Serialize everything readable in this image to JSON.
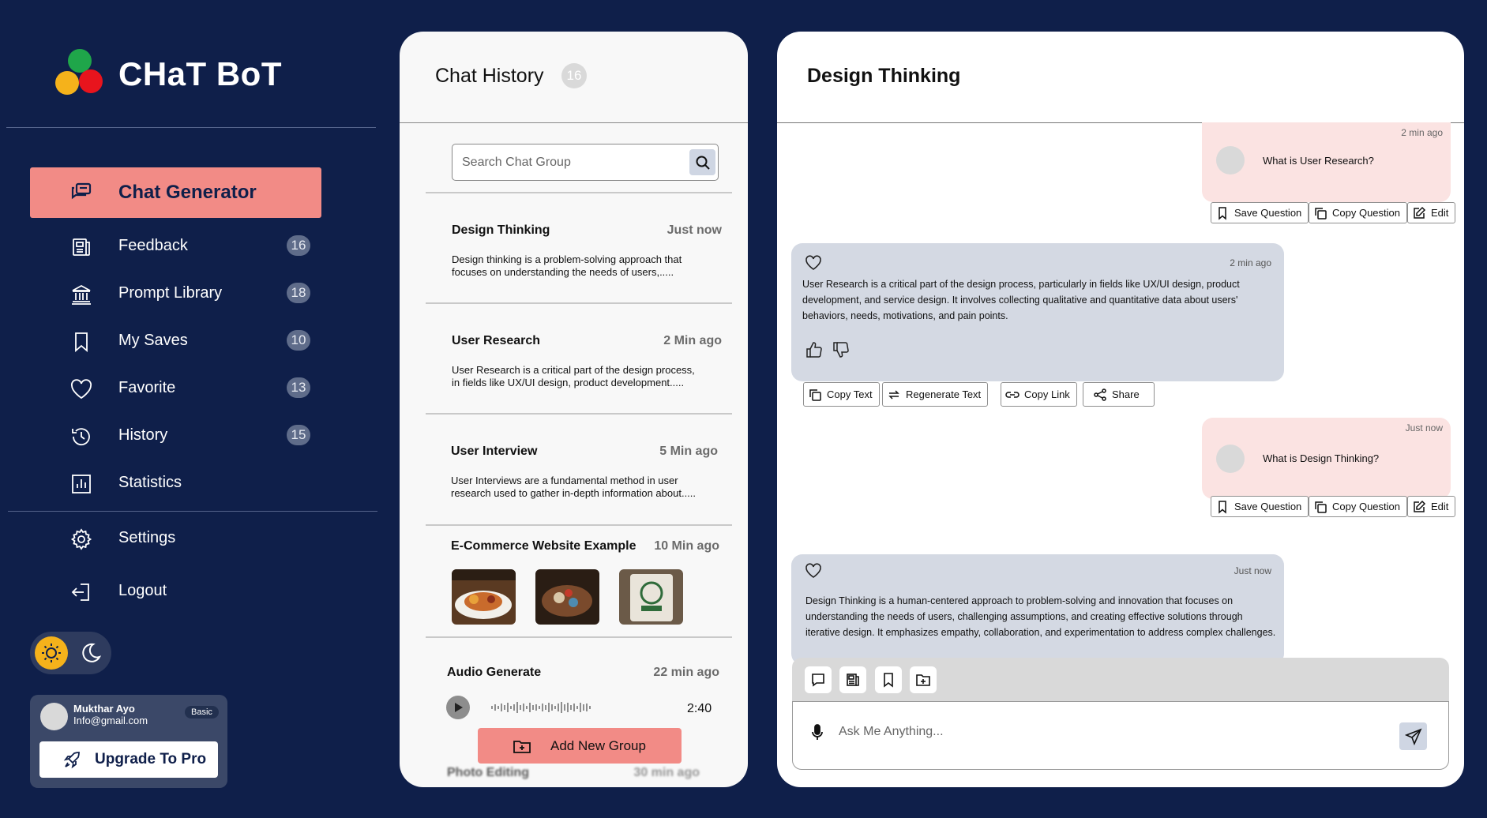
{
  "app": {
    "brand": "CHaT BoT"
  },
  "sidebar": {
    "active": {
      "label": "Chat Generator",
      "icon": "chat-icon"
    },
    "items": [
      {
        "label": "Feedback",
        "count": "16",
        "icon": "feedback-icon"
      },
      {
        "label": "Prompt Library",
        "count": "18",
        "icon": "library-icon"
      },
      {
        "label": "My Saves",
        "count": "10",
        "icon": "bookmark-icon"
      },
      {
        "label": "Favorite",
        "count": "13",
        "icon": "heart-icon"
      },
      {
        "label": "History",
        "count": "15",
        "icon": "history-icon"
      },
      {
        "label": "Statistics",
        "icon": "statistics-icon"
      }
    ],
    "settings": "Settings",
    "logout": "Logout"
  },
  "user": {
    "name": "Mukthar Ayo",
    "email": "Info@gmail.com",
    "plan": "Basic",
    "upgrade_label": "Upgrade To Pro"
  },
  "history": {
    "title": "Chat History",
    "count": "16",
    "search_placeholder": "Search Chat Group",
    "items": [
      {
        "title": "Design Thinking",
        "time": "Just now",
        "text": "Design thinking is a problem-solving approach that focuses on understanding the needs of users,....."
      },
      {
        "title": "User Research",
        "time": "2 Min ago",
        "text": "User Research is a critical part of the design process, in fields like UX/UI design, product development....."
      },
      {
        "title": "User Interview",
        "time": "5 Min ago",
        "text": "User Interviews are a fundamental method in user research used to gather in-depth information about....."
      },
      {
        "title": "E-Commerce Website Example",
        "time": "10 Min ago"
      },
      {
        "title": "Audio Generate",
        "time": "22 min ago",
        "duration": "2:40"
      },
      {
        "title": "Photo  Editing",
        "time": "30 min ago"
      }
    ],
    "add_group_label": "Add New Group"
  },
  "chat": {
    "title": "Design Thinking",
    "messages": [
      {
        "role": "user",
        "time": "2 min ago",
        "text": "What is User Research?"
      },
      {
        "role": "bot",
        "time": "2 min ago",
        "text": "User Research is a critical part of the design process, particularly in fields like UX/UI design, product development, and service design. It involves collecting qualitative and quantitative data about users' behaviors, needs, motivations, and pain points."
      },
      {
        "role": "user",
        "time": "Just now",
        "text": "What is Design Thinking?"
      },
      {
        "role": "bot",
        "time": "Just now",
        "text": "Design Thinking is a human-centered approach to problem-solving and innovation that focuses on understanding the needs of users, challenging assumptions, and creating effective solutions through iterative design. It emphasizes empathy, collaboration, and experimentation to address complex challenges."
      }
    ],
    "question_actions": {
      "save": "Save Question",
      "copy": "Copy Question",
      "edit": "Edit"
    },
    "answer_actions": {
      "copy_text": "Copy Text",
      "regenerate": "Regenerate Text",
      "copy_link": "Copy Link",
      "share": "Share"
    },
    "input_placeholder": "Ask Me Anything..."
  },
  "colors": {
    "background": "#0f1f4a",
    "accent": "#f28b86",
    "user_bubble": "#fbe3e2",
    "bot_bubble": "#d4d9e3"
  }
}
